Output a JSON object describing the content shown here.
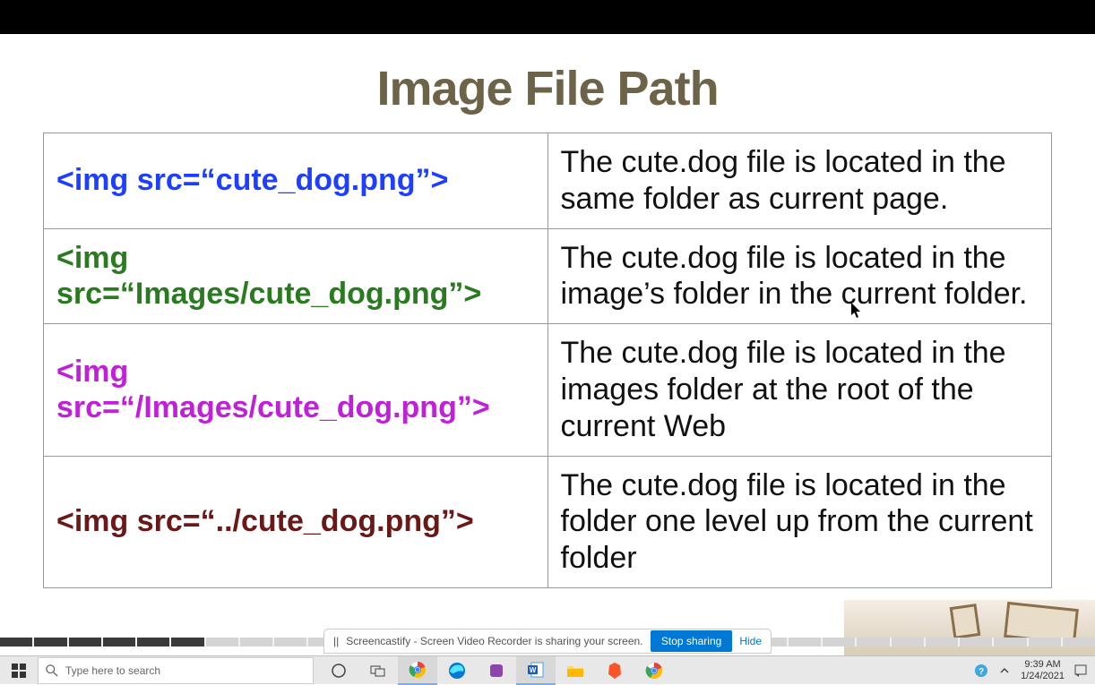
{
  "title": "Image File Path",
  "rows": [
    {
      "code": "<img src=“cute_dog.png”>",
      "color": "code-blue",
      "desc": "The cute.dog file is located in the same folder as current page."
    },
    {
      "code": "<img src=“Images/cute_dog.png”>",
      "color": "code-green",
      "desc": "The cute.dog file is located in the image’s folder in the current folder."
    },
    {
      "code": "<img src=“/Images/cute_dog.png”>",
      "color": "code-purple",
      "desc": "The cute.dog file is located in the images folder at the root of the current Web"
    },
    {
      "code": "<img src=“../cute_dog.png”>",
      "color": "code-maroon",
      "desc": "The cute.dog file is located in the folder one level up from the current folder"
    }
  ],
  "sharebar": {
    "icon": "||",
    "message": "Screencastify - Screen Video Recorder is sharing your screen.",
    "stop_label": "Stop sharing",
    "hide_label": "Hide"
  },
  "taskbar": {
    "search_placeholder": "Type here to search",
    "time": "9:39 AM",
    "date": "1/24/2021"
  }
}
